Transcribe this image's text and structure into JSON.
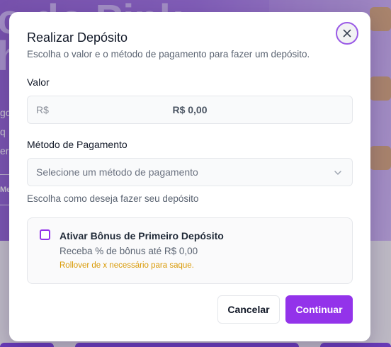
{
  "background": {
    "hero_line1": "o do Pink",
    "hero_line2": "h",
    "body_lines": [
      "go",
      "q",
      "er"
    ],
    "side_button": "Me"
  },
  "modal": {
    "title": "Realizar Depósito",
    "subtitle": "Escolha o valor e o método de pagamento para fazer um depósito.",
    "close_icon": "close-icon",
    "amount": {
      "label": "Valor",
      "prefix": "R$",
      "value": "R$ 0,00"
    },
    "payment_method": {
      "label": "Método de Pagamento",
      "placeholder": "Selecione um método de pagamento",
      "helper": "Escolha como deseja fazer seu depósito",
      "icon": "chevron-down-icon"
    },
    "bonus": {
      "checked": false,
      "title": "Ativar Bônus de Primeiro Depósito",
      "description": "Receba % de bônus até R$ 0,00",
      "note": "Rollover de x necessário para saque."
    },
    "buttons": {
      "cancel": "Cancelar",
      "continue": "Continuar"
    }
  },
  "colors": {
    "accent": "#9333ea",
    "warning": "#d99a06",
    "background_gradient_start": "#8e5ed1"
  }
}
